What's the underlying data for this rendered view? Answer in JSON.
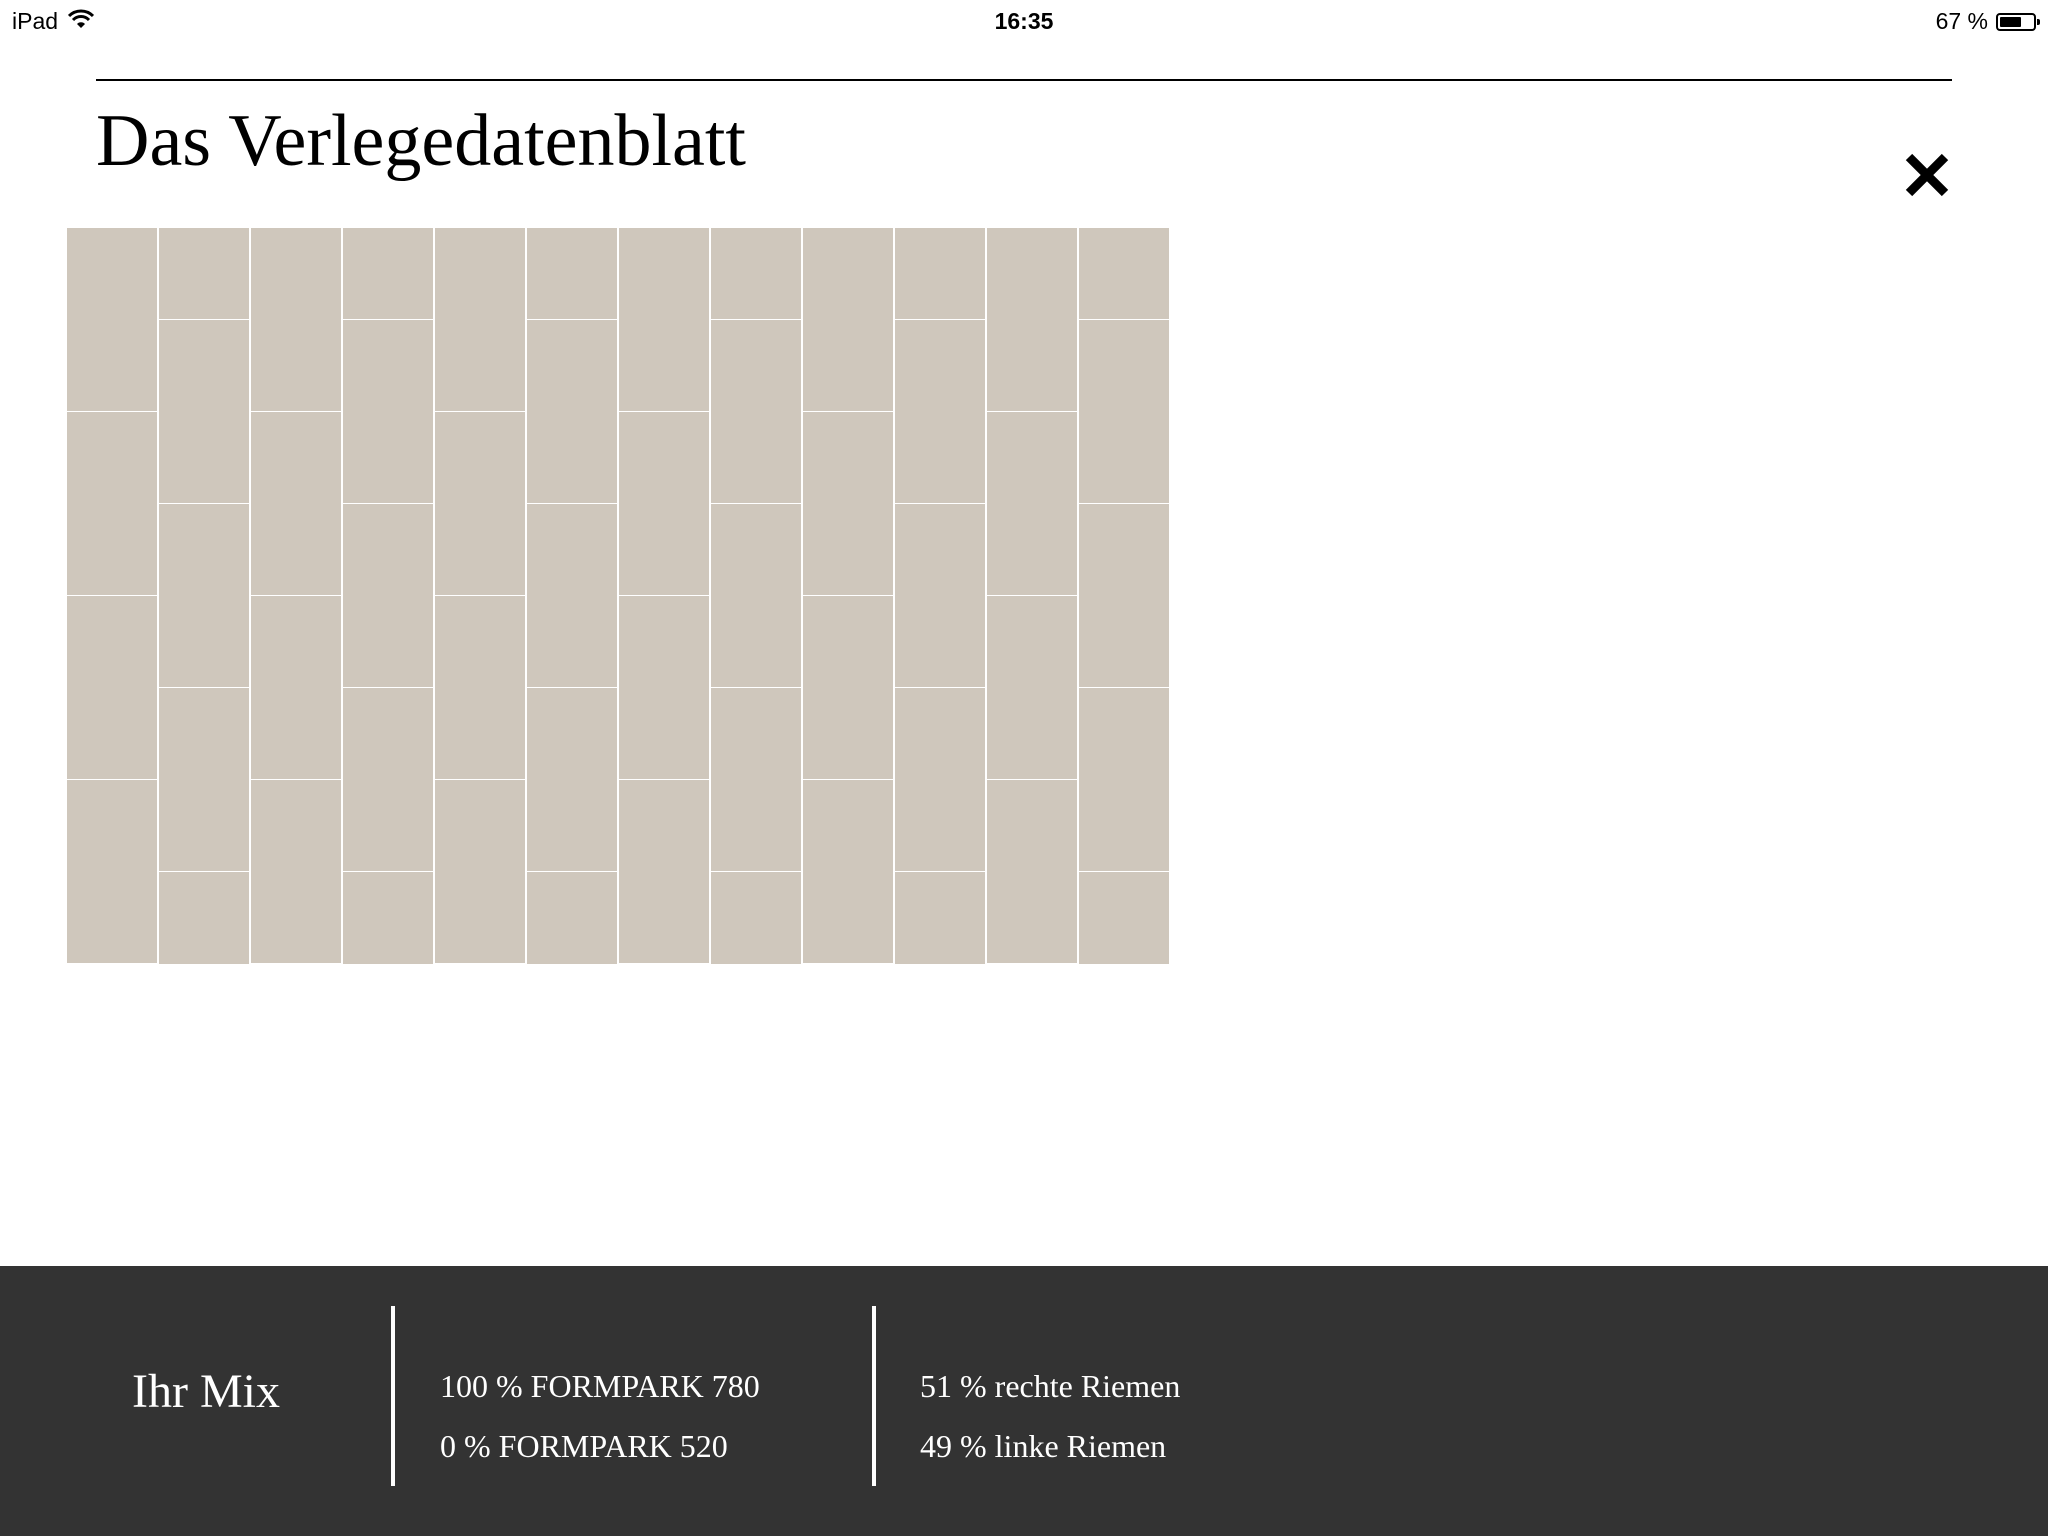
{
  "status_bar": {
    "device": "iPad",
    "time": "16:35",
    "battery_text": "67 %",
    "battery_level": 0.67,
    "wifi_icon": "wifi-icon",
    "battery_icon": "battery-icon"
  },
  "header": {
    "title": "Das Verlegedatenblatt",
    "close_icon": "close-icon"
  },
  "pattern": {
    "colors": {
      "light": "#d8d2cb",
      "dark": "#cfc7bc",
      "gap": "#ffffff"
    },
    "rows": 8,
    "columns": 12
  },
  "footer": {
    "label": "Ihr Mix",
    "products": [
      "100 % FORMPARK 780",
      "0 % FORMPARK 520"
    ],
    "strips": [
      "51 % rechte Riemen",
      "49 % linke Riemen"
    ]
  }
}
